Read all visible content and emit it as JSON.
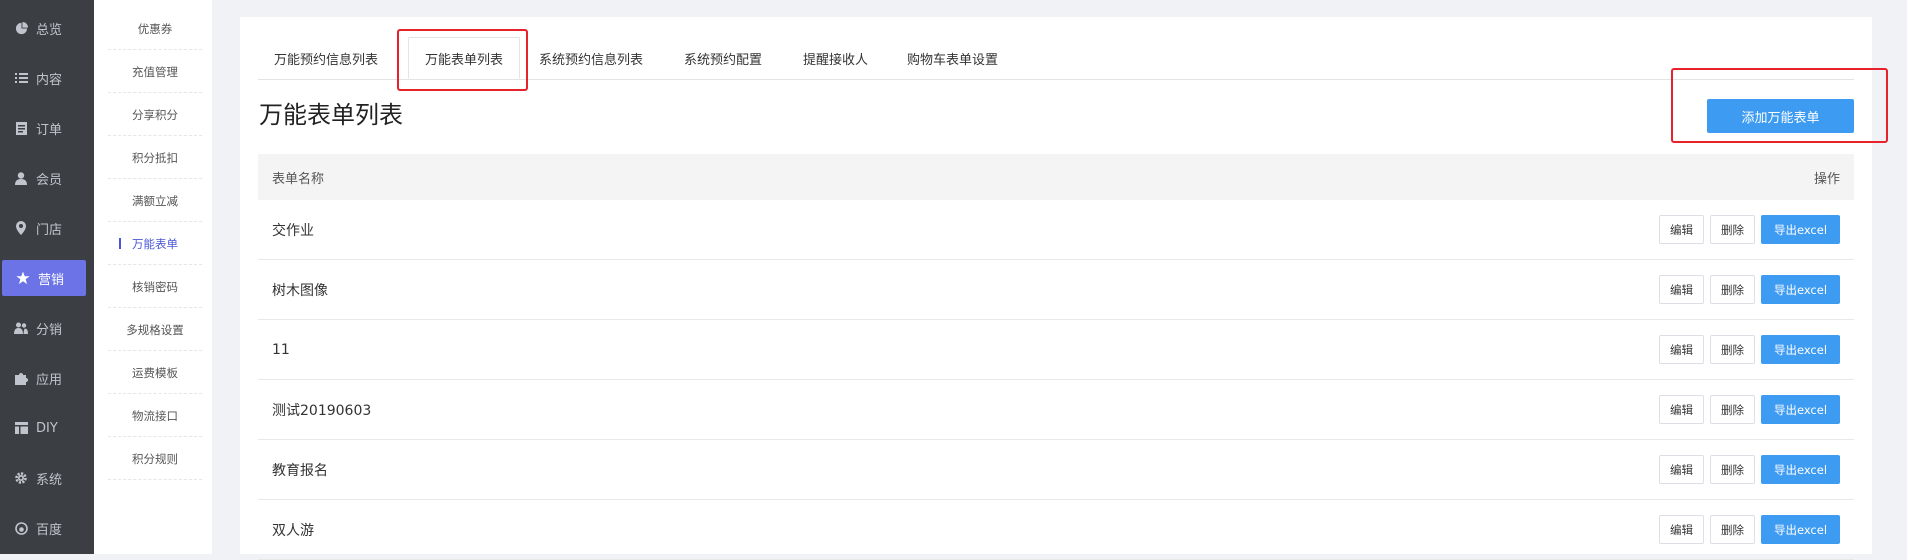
{
  "sidebar": {
    "items": [
      {
        "label": "总览",
        "icon": "pie-chart-icon"
      },
      {
        "label": "内容",
        "icon": "list-icon"
      },
      {
        "label": "订单",
        "icon": "document-icon"
      },
      {
        "label": "会员",
        "icon": "user-icon"
      },
      {
        "label": "门店",
        "icon": "location-pin-icon"
      },
      {
        "label": "营销",
        "icon": "star-icon",
        "active": true
      },
      {
        "label": "分销",
        "icon": "users-icon"
      },
      {
        "label": "应用",
        "icon": "puzzle-icon"
      },
      {
        "label": "DIY",
        "icon": "layout-icon"
      },
      {
        "label": "系统",
        "icon": "gear-icon"
      },
      {
        "label": "百度",
        "icon": "baidu-icon"
      }
    ]
  },
  "subnav": {
    "items": [
      {
        "label": "优惠券"
      },
      {
        "label": "充值管理"
      },
      {
        "label": "分享积分"
      },
      {
        "label": "积分抵扣"
      },
      {
        "label": "满额立减"
      },
      {
        "label": "万能表单",
        "active": true
      },
      {
        "label": "核销密码"
      },
      {
        "label": "多规格设置"
      },
      {
        "label": "运费模板"
      },
      {
        "label": "物流接口"
      },
      {
        "label": "积分规则"
      }
    ]
  },
  "tabs": [
    {
      "label": "万能预约信息列表"
    },
    {
      "label": "万能表单列表",
      "active": true
    },
    {
      "label": "系统预约信息列表"
    },
    {
      "label": "系统预约配置"
    },
    {
      "label": "提醒接收人"
    },
    {
      "label": "购物车表单设置"
    }
  ],
  "page": {
    "title": "万能表单列表",
    "add_button": "添加万能表单"
  },
  "table": {
    "columns": {
      "name": "表单名称",
      "ops": "操作"
    },
    "rows": [
      {
        "name": "交作业"
      },
      {
        "name": "树木图像"
      },
      {
        "name": "11"
      },
      {
        "name": "测试20190603"
      },
      {
        "name": "教育报名"
      },
      {
        "name": "双人游"
      }
    ],
    "edit_label": "编辑",
    "delete_label": "删除",
    "export_label": "导出excel"
  },
  "colors": {
    "accent": "#3d9bf2",
    "active_nav": "#6b73e6",
    "highlight_box": "#e8222a"
  }
}
